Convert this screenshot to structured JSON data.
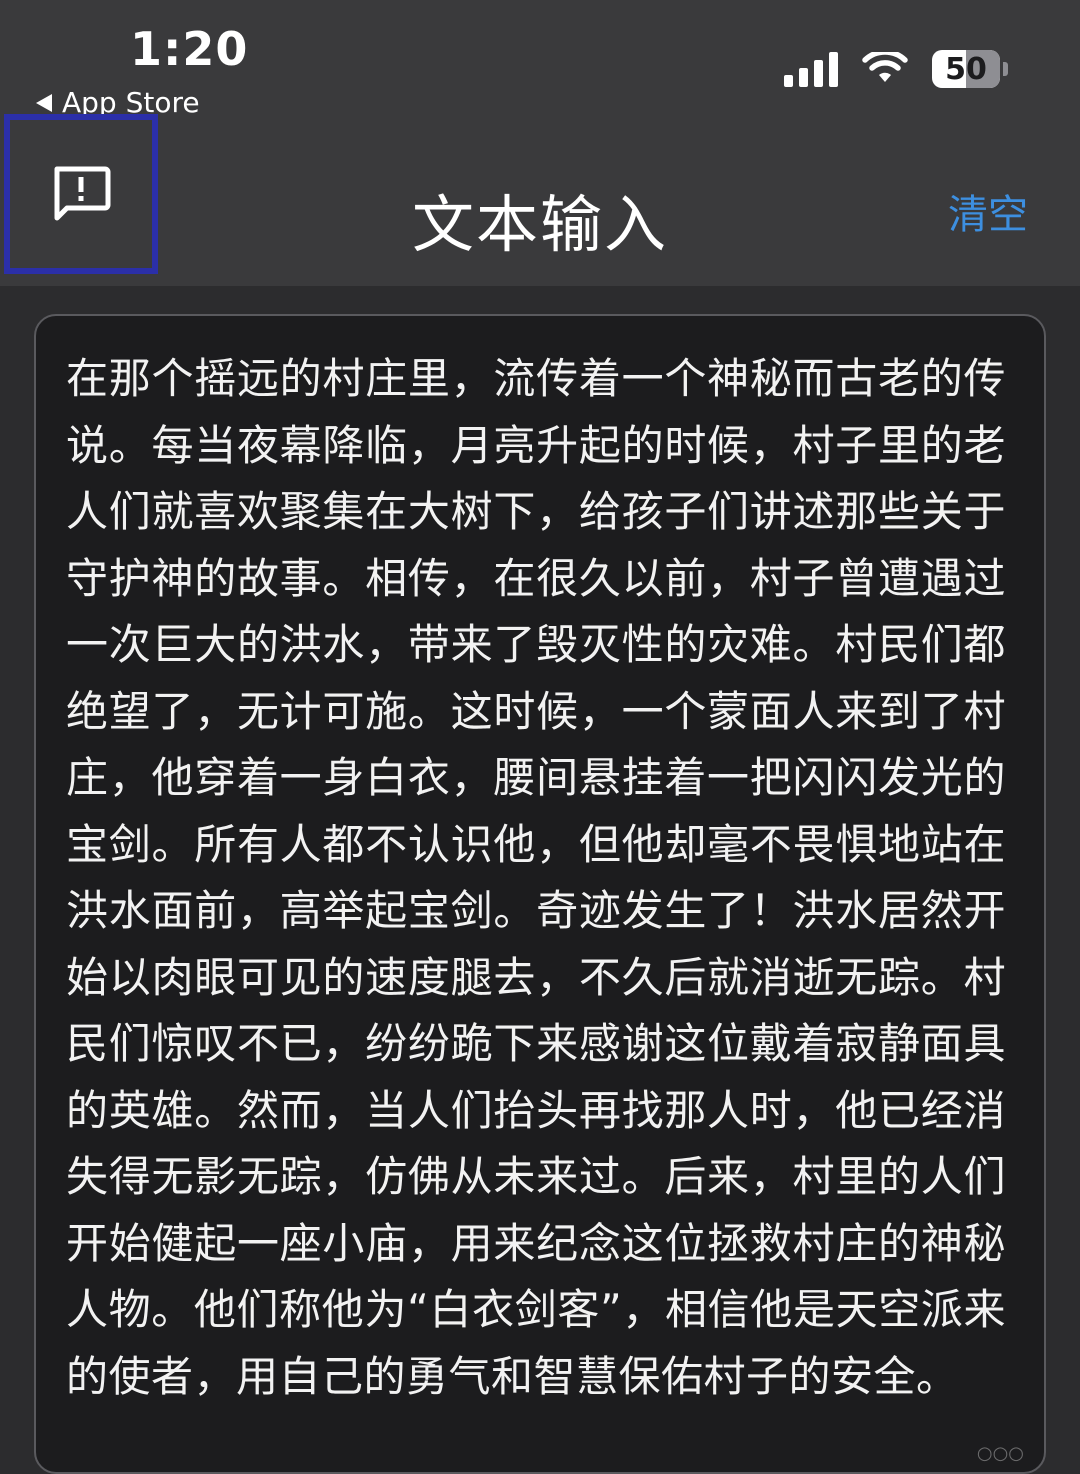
{
  "status_bar": {
    "time": "1:20",
    "back_app": "App Store",
    "battery_percent": "50",
    "battery_level": 0.5
  },
  "nav": {
    "title": "文本输入",
    "clear_label": "清空"
  },
  "editor": {
    "text": "在那个摇远的村庄里，流传着一个神秘而古老的传说。每当夜幕降临，月亮升起的时候，村子里的老人们就喜欢聚集在大树下，给孩子们讲述那些关于守护神的故事。相传，在很久以前，村子曾遭遇过一次巨大的洪水，带来了毁灭性的灾难。村民们都绝望了，无计可施。这时候，一个蒙面人来到了村庄，他穿着一身白衣，腰间悬挂着一把闪闪发光的宝剑。所有人都不认识他，但他却毫不畏惧地站在洪水面前，高举起宝剑。奇迹发生了！洪水居然开始以肉眼可见的速度腿去，不久后就消逝无踪。村民们惊叹不已，纷纷跪下来感谢这位戴着寂静面具的英雄。然而，当人们抬头再找那人时，他已经消失得无影无踪，仿佛从未来过。后来，村里的人们开始健起一座小庙，用来纪念这位拯救村庄的神秘人物。他们称他为“白衣剑客”，相信他是天空派来的使者，用自己的勇气和智慧保佑村子的安全。"
  }
}
